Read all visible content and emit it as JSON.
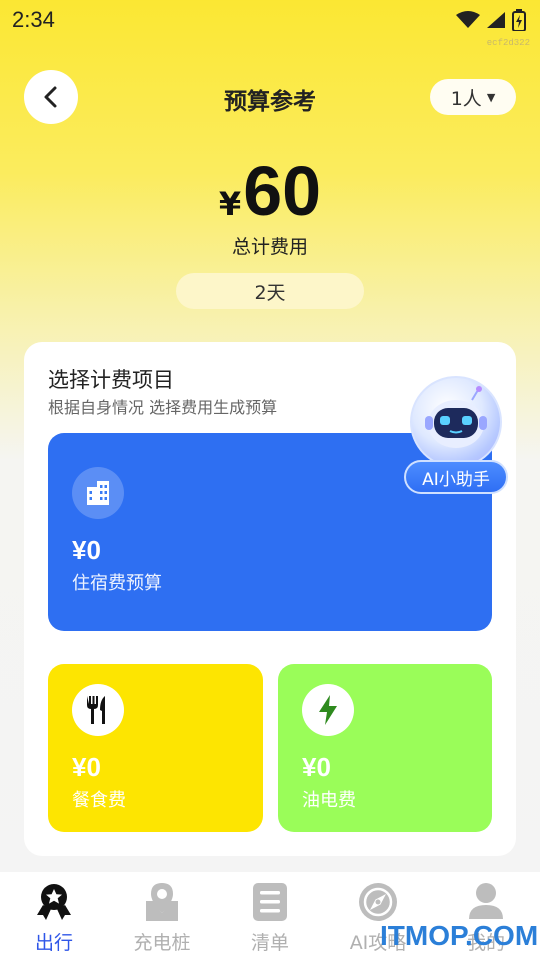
{
  "status_bar": {
    "time": "2:34"
  },
  "debug_tag": "ecf2d322",
  "header": {
    "title": "预算参考",
    "back_icon": "chevron-left-icon",
    "people_select": {
      "value": "1人"
    }
  },
  "total": {
    "currency": "¥",
    "amount": "60",
    "label": "总计费用",
    "days": "2天"
  },
  "card": {
    "title": "选择计费项目",
    "subtitle": "根据自身情况 选择费用生成预算",
    "items": [
      {
        "key": "lodging",
        "amount": "¥0",
        "label": "住宿费预算",
        "icon": "building-icon",
        "color": "#2e6ff2"
      },
      {
        "key": "food",
        "amount": "¥0",
        "label": "餐食费",
        "icon": "fork-knife-icon",
        "color": "#fde501"
      },
      {
        "key": "fuel",
        "amount": "¥0",
        "label": "油电费",
        "icon": "lightning-icon",
        "color": "#9afd59"
      }
    ]
  },
  "ai_helper": {
    "label": "AI小助手",
    "icon": "robot-icon"
  },
  "tabbar": {
    "tabs": [
      {
        "label": "出行",
        "icon": "travel-badge-icon",
        "active": true
      },
      {
        "label": "充电桩",
        "icon": "map-pin-icon",
        "active": false
      },
      {
        "label": "清单",
        "icon": "list-icon",
        "active": false
      },
      {
        "label": "AI攻略",
        "icon": "compass-icon",
        "active": false
      },
      {
        "label": "我的",
        "icon": "user-icon",
        "active": false
      }
    ]
  },
  "watermark": "ITMOP.COM",
  "colors": {
    "accent_yellow": "#fbe733",
    "active_tab": "#2f56e8",
    "lodging": "#2e6ff2",
    "food": "#fde501",
    "fuel": "#9afd59"
  }
}
